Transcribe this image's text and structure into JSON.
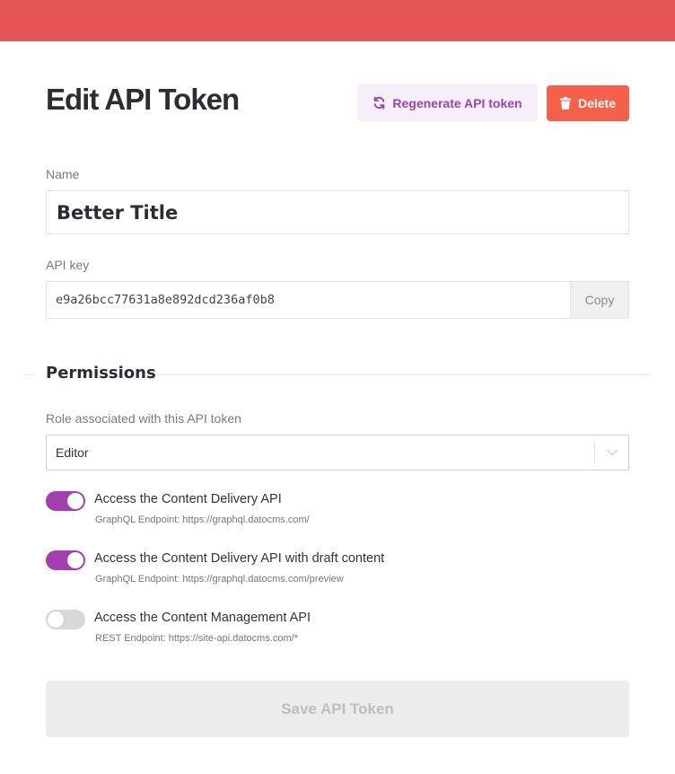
{
  "colors": {
    "topbar": "#e55558",
    "accent": "#a13fb0",
    "danger": "#f5604a",
    "regenerate_bg": "#f6eef8",
    "regenerate_text": "#9b45b0"
  },
  "header": {
    "title": "Edit API Token",
    "regenerate_label": "Regenerate API token",
    "regenerate_icon": "refresh-icon",
    "delete_label": "Delete",
    "delete_icon": "trash-icon"
  },
  "form": {
    "name_label": "Name",
    "name_value": "Better Title",
    "api_key_label": "API key",
    "api_key_value": "e9a26bcc77631a8e892dcd236af0b8",
    "copy_label": "Copy"
  },
  "permissions": {
    "section_title": "Permissions",
    "role_label": "Role associated with this API token",
    "role_value": "Editor",
    "items": [
      {
        "title": "Access the Content Delivery API",
        "subtitle": "GraphQL Endpoint: https://graphql.datocms.com/",
        "enabled": true
      },
      {
        "title": "Access the Content Delivery API with draft content",
        "subtitle": "GraphQL Endpoint: https://graphql.datocms.com/preview",
        "enabled": true
      },
      {
        "title": "Access the Content Management API",
        "subtitle": "REST Endpoint: https://site-api.datocms.com/*",
        "enabled": false
      }
    ]
  },
  "footer": {
    "save_label": "Save API Token"
  }
}
